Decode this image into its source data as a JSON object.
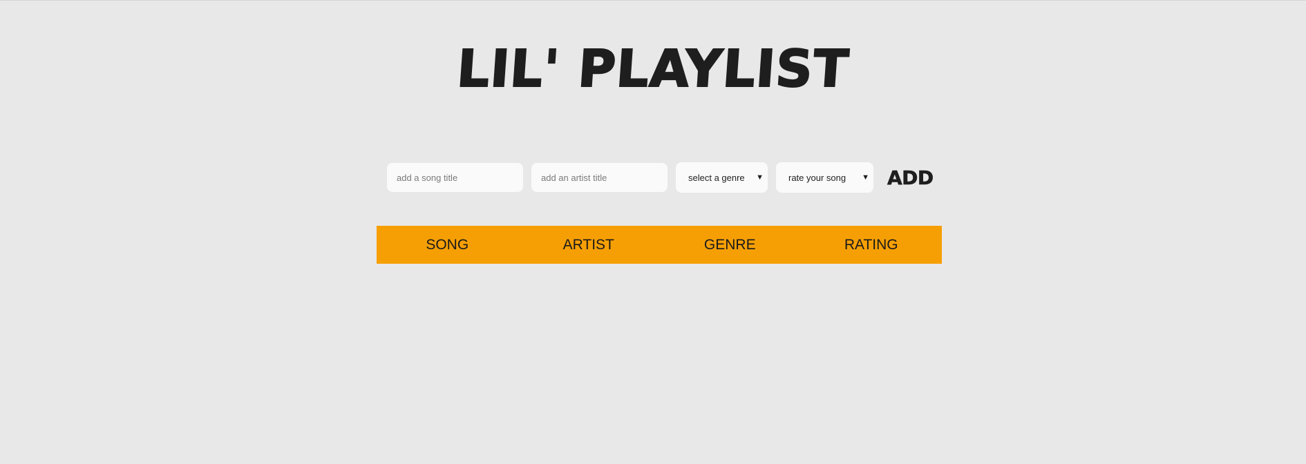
{
  "app": {
    "title": "LIL' PLAYLIST"
  },
  "form": {
    "song_placeholder": "add a song title",
    "artist_placeholder": "add an artist title",
    "genre_select": {
      "selected": "select a genre"
    },
    "rating_select": {
      "selected": "rate your song"
    },
    "add_label": "ADD"
  },
  "table": {
    "columns": [
      "SONG",
      "ARTIST",
      "GENRE",
      "RATING"
    ],
    "rows": []
  },
  "colors": {
    "background": "#e8e8e8",
    "header_bar": "#f69f05",
    "text": "#1e1e1e",
    "field": "#fafafa"
  }
}
